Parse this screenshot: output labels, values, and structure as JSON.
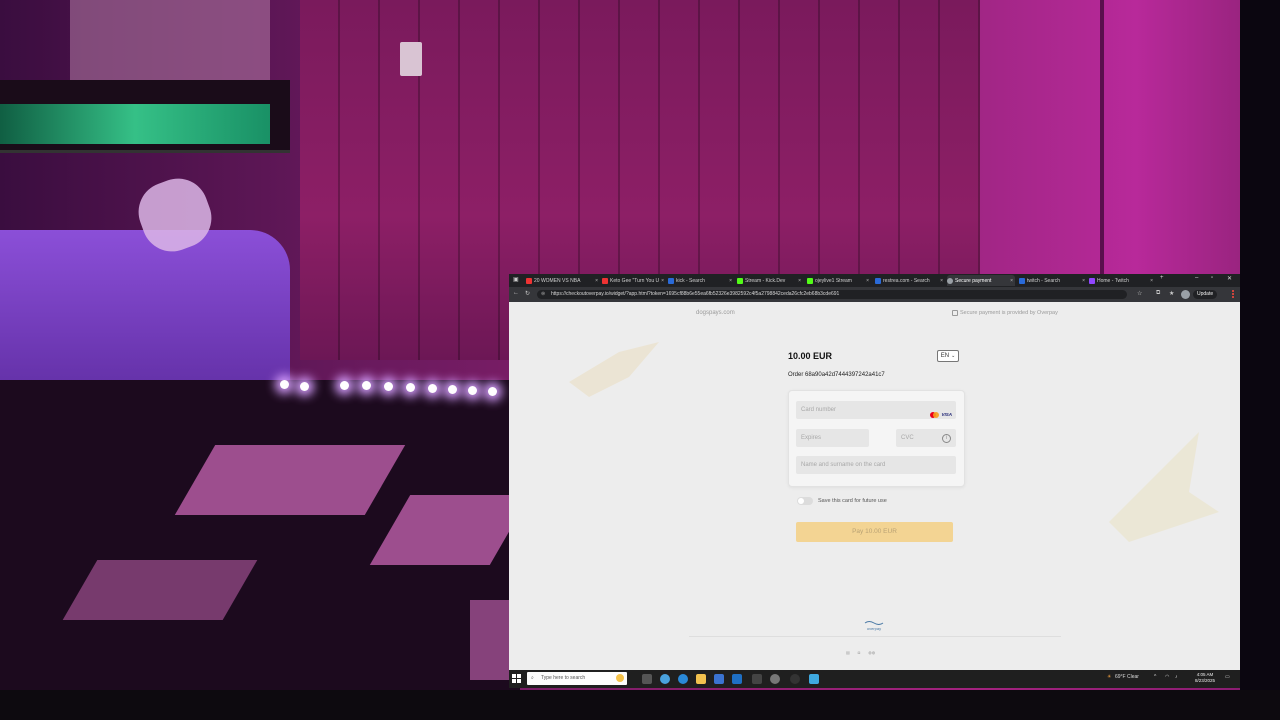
{
  "browser": {
    "tabs": [
      {
        "label": "20 WOMEN VS NBA",
        "close": "×"
      },
      {
        "label": "Keto Gee \"Turn You U",
        "close": "×"
      },
      {
        "label": "kick - Search",
        "close": "×"
      },
      {
        "label": "Stream - Kick.Dev",
        "close": "×"
      },
      {
        "label": "ojeylive1 Stream",
        "close": "×"
      },
      {
        "label": "restrea.com - Search",
        "close": "×"
      },
      {
        "label": "Secure payment",
        "close": "×"
      },
      {
        "label": "twitch - Search",
        "close": "×"
      },
      {
        "label": "Home - Twitch",
        "close": "×"
      }
    ],
    "new_tab": "+",
    "url": "https://checkoutoverpay.io/widget/?app.html?token=1695cf88b6e55ea6fb52326e3982592c4f5a2798842ceda26cfc2eb68b3cde691",
    "update_label": "Update"
  },
  "page": {
    "brand": "dogspays.com",
    "secure_note": "Secure payment is provided by Overpay",
    "amount": "10.00 EUR",
    "language": "EN",
    "order": "Order 68a90a42d7444397242a41c7",
    "card_number_placeholder": "Card number",
    "visa_label": "VISA",
    "expires_placeholder": "Expires",
    "cvc_placeholder": "CVC",
    "name_placeholder": "Name and surname on the card",
    "save_card_label": "Save this card for future use",
    "pay_button": "Pay 10.00 EUR",
    "footer_logo": "overpay"
  },
  "taskbar": {
    "search_placeholder": "Type here to search",
    "weather": "69°F Clear",
    "time": "4:05 AM",
    "date": "8/23/2025"
  }
}
